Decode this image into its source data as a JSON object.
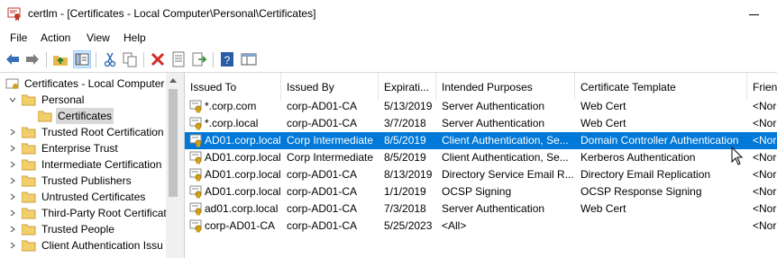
{
  "window": {
    "title": "certlm - [Certificates - Local Computer\\Personal\\Certificates]"
  },
  "menu": [
    {
      "label": "File"
    },
    {
      "label": "Action"
    },
    {
      "label": "View"
    },
    {
      "label": "Help"
    }
  ],
  "toolbar": {
    "buttons": [
      "back-icon",
      "forward-icon",
      "up-folder-icon",
      "show-hide-tree-icon",
      "cut-icon",
      "copy-icon",
      "delete-icon",
      "properties-icon",
      "export-icon",
      "help-icon",
      "console-icon"
    ]
  },
  "tree": {
    "root": "Certificates - Local Computer",
    "items": [
      {
        "label": "Personal",
        "expanded": true
      },
      {
        "label": "Certificates",
        "selected": true
      },
      {
        "label": "Trusted Root Certification"
      },
      {
        "label": "Enterprise Trust"
      },
      {
        "label": "Intermediate Certification"
      },
      {
        "label": "Trusted Publishers"
      },
      {
        "label": "Untrusted Certificates"
      },
      {
        "label": "Third-Party Root Certificat"
      },
      {
        "label": "Trusted People"
      },
      {
        "label": "Client Authentication Issu"
      }
    ]
  },
  "list": {
    "columns": [
      "Issued To",
      "Issued By",
      "Expirati...",
      "Intended Purposes",
      "Certificate Template",
      "Frien"
    ],
    "rows": [
      [
        "*.corp.com",
        "corp-AD01-CA",
        "5/13/2019",
        "Server Authentication",
        "Web Cert",
        "<Nor"
      ],
      [
        "*.corp.local",
        "corp-AD01-CA",
        "3/7/2018",
        "Server Authentication",
        "Web Cert",
        "<Nor"
      ],
      [
        "AD01.corp.local",
        "Corp Intermediate",
        "8/5/2019",
        "Client Authentication, Se...",
        "Domain Controller Authentication",
        "<Nor"
      ],
      [
        "AD01.corp.local",
        "Corp Intermediate",
        "8/5/2019",
        "Client Authentication, Se...",
        "Kerberos Authentication",
        "<Nor"
      ],
      [
        "AD01.corp.local",
        "corp-AD01-CA",
        "8/13/2019",
        "Directory Service Email R...",
        "Directory Email Replication",
        "<Nor"
      ],
      [
        "AD01.corp.local",
        "corp-AD01-CA",
        "1/1/2019",
        "OCSP Signing",
        "OCSP Response Signing",
        "<Nor"
      ],
      [
        "ad01.corp.local",
        "corp-AD01-CA",
        "7/3/2018",
        "Server Authentication",
        "Web Cert",
        "<Nor"
      ],
      [
        "corp-AD01-CA",
        "corp-AD01-CA",
        "5/25/2023",
        "<All>",
        "",
        "<Nor"
      ]
    ],
    "selected_row": 2
  },
  "colors": {
    "selection": "#0078d7",
    "tree_selection": "#d9d9d9"
  }
}
